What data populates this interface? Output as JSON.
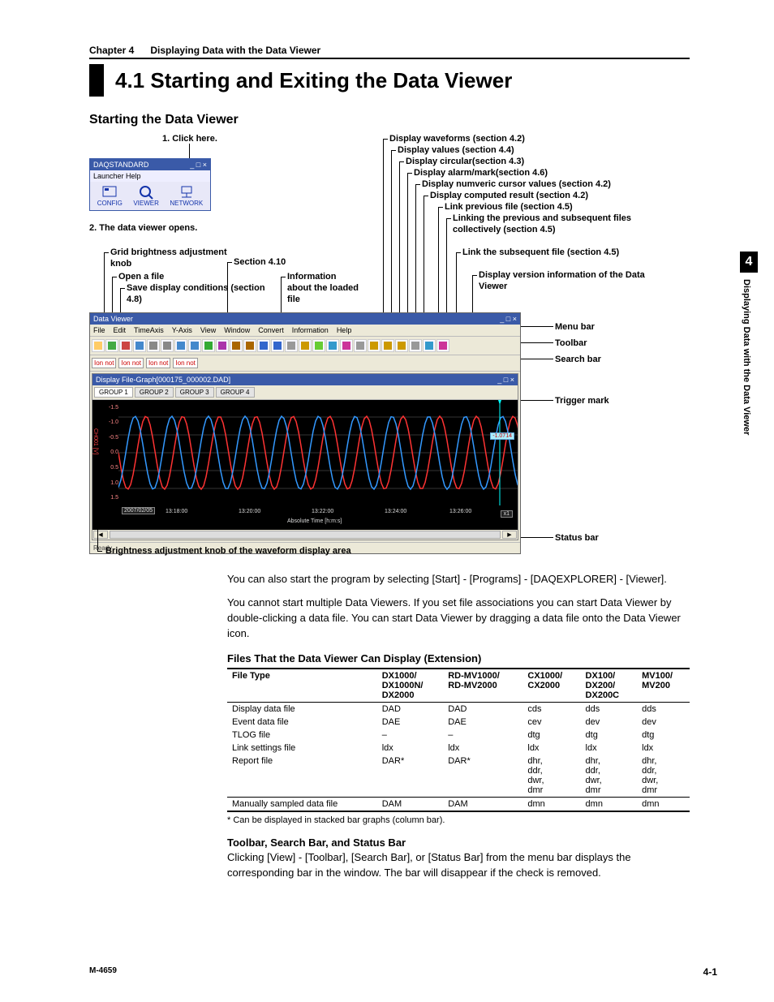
{
  "chapter_line": {
    "left": "Chapter 4",
    "right": "Displaying Data with the Data Viewer"
  },
  "title": "4.1    Starting and Exiting the Data Viewer",
  "subhead": "Starting the Data Viewer",
  "diagram": {
    "step1": "1. Click here.",
    "step2": "2. The data viewer opens.",
    "launcher": {
      "title": "DAQSTANDARD",
      "menu": "Launcher   Help",
      "icons": [
        "CONFIG",
        "VIEWER",
        "NETWORK"
      ]
    },
    "toolbar_right_labels": [
      "Display waveforms (section 4.2)",
      "Display values (section 4.4)",
      "Display circular(section 4.3)",
      "Display alarm/mark(section 4.6)",
      "Display numveric cursor values (section 4.2)",
      "Display computed result (section 4.2)",
      "Link previous file (section 4.5)",
      "Linking the previous and subsequent files collectively (section 4.5)",
      "Link the subsequent file (section 4.5)",
      "Display version information of the Data Viewer"
    ],
    "left_labels": {
      "grid": "Grid brightness adjustment knob",
      "open": "Open a file",
      "save": "Save display conditions (section 4.8)",
      "s410": "Section 4.10",
      "info": "Information about the loaded file"
    },
    "right_bar_labels": {
      "menu": "Menu bar",
      "toolbar": "Toolbar",
      "search": "Search bar",
      "trigger": "Trigger mark",
      "status": "Status bar"
    },
    "dv": {
      "title": "Data Viewer",
      "menus": [
        "File",
        "Edit",
        "TimeAxis",
        "Y-Axis",
        "View",
        "Window",
        "Convert",
        "Information",
        "Help"
      ],
      "search_items": [
        "Ion not",
        "Ion not",
        "Ion not",
        "Ion not"
      ],
      "doc_title": "Display File-Graph[000175_000002.DAD]",
      "tabs": [
        "GROUP 1",
        "GROUP 2",
        "GROUP 3",
        "GROUP 4"
      ],
      "yvals": [
        "-1.5",
        "-1.0",
        "-0.5",
        "0.0",
        "0.5",
        "1.0",
        "1.5"
      ],
      "yunit": "CH001 [V]",
      "mark": "-1.0714",
      "xticks": [
        "13:18:00",
        "13:20:00",
        "13:22:00",
        "13:24:00",
        "13:26:00"
      ],
      "xdate": "2007/02/05",
      "xlabel": "Absolute Time [h:m:s]",
      "x1": "x1",
      "status": "Ready"
    },
    "bottom_label": "Brightness adjustment knob of the waveform display area"
  },
  "para1": "You can also start the program by selecting [Start] - [Programs] - [DAQEXPLORER] - [Viewer].",
  "para2": "You cannot start multiple Data Viewers.  If you set file associations you can start Data Viewer by double-clicking a data file.  You can start Data Viewer by dragging a data file onto the Data Viewer icon.",
  "table": {
    "title": "Files That the Data Viewer Can Display (Extension)",
    "headers": [
      "File Type",
      "DX1000/ DX1000N/ DX2000",
      "RD-MV1000/ RD-MV2000",
      "CX1000/ CX2000",
      "DX100/ DX200/ DX200C",
      "MV100/ MV200"
    ],
    "rows": [
      [
        "Display data file",
        "DAD",
        "DAD",
        "cds",
        "dds",
        "dds"
      ],
      [
        "Event data file",
        "DAE",
        "DAE",
        "cev",
        "dev",
        "dev"
      ],
      [
        "TLOG file",
        "–",
        "–",
        "dtg",
        "dtg",
        "dtg"
      ],
      [
        "Link settings file",
        "ldx",
        "ldx",
        "ldx",
        "ldx",
        "ldx"
      ],
      [
        "Report file",
        "DAR*",
        "DAR*",
        "dhr, ddr, dwr, dmr",
        "dhr, ddr, dwr, dmr",
        "dhr, ddr, dwr, dmr"
      ],
      [
        "Manually sampled data file",
        "DAM",
        "DAM",
        "dmn",
        "dmn",
        "dmn"
      ]
    ],
    "note": "*   Can be displayed in stacked bar graphs (column bar)."
  },
  "subhead2": "Toolbar, Search Bar, and Status Bar",
  "para3": "Clicking [View] - [Toolbar], [Search Bar], or [Status Bar] from the menu bar displays the corresponding bar in the window.  The bar will disappear if the check is removed.",
  "sidetab": {
    "num": "4",
    "text": "Displaying Data with the Data Viewer"
  },
  "footer": {
    "left": "M-4659",
    "right": "4-1"
  }
}
